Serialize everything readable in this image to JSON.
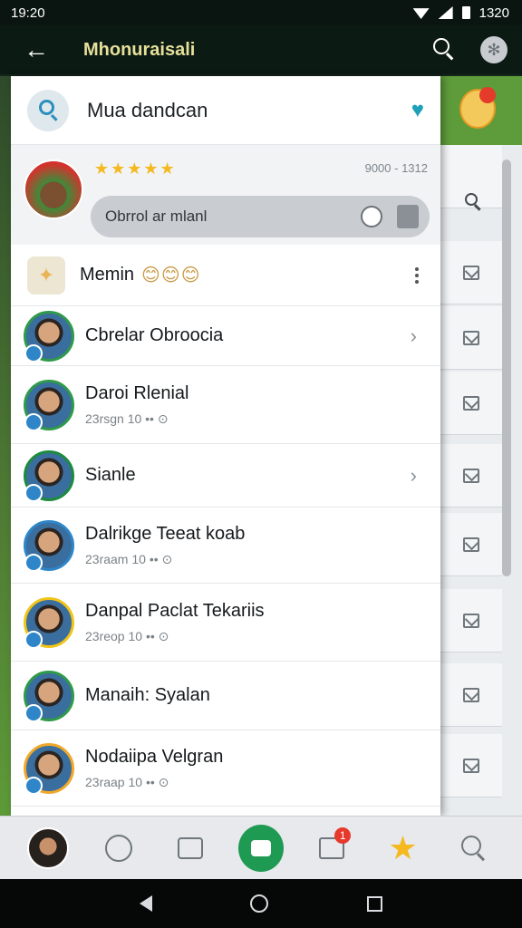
{
  "status_bar": {
    "time": "19:20",
    "battery_text": "1320"
  },
  "app_bar": {
    "title": "Mhonuraisali"
  },
  "drawer": {
    "search": {
      "text": "Mua dandcan"
    },
    "profile": {
      "stars": "★★★★★",
      "stat": "9000 - 1312",
      "status_text": "Obrrol ar mlanl"
    },
    "menu": {
      "label": "Memin",
      "emojis": "😊😊😊"
    },
    "contacts": [
      {
        "name": "Cbrelar Obroocia",
        "meta": "",
        "chevron": "›"
      },
      {
        "name": "Daroi Rlenial",
        "meta": "23rsgn 10 •• ⊙",
        "chevron": ""
      },
      {
        "name": "Sianle",
        "meta": "",
        "chevron": "›"
      },
      {
        "name": "Dalrikge Teeat koab",
        "meta": "23raam 10 •• ⊙",
        "chevron": ""
      },
      {
        "name": "Danpal Paclat Tekariis",
        "meta": "23reop 10 •• ⊙",
        "chevron": ""
      },
      {
        "name": "Manaih: Syalan",
        "meta": "",
        "chevron": ""
      },
      {
        "name": "Nodaiipa Velgran",
        "meta": "23raap 10 •• ⊙",
        "chevron": ""
      }
    ]
  },
  "bottom_nav": {
    "chat_badge": "1"
  },
  "colors": {
    "accent_green": "#1f9a52",
    "star": "#f5b81e",
    "heart": "#1ea0b8",
    "badge_red": "#e6392c"
  }
}
